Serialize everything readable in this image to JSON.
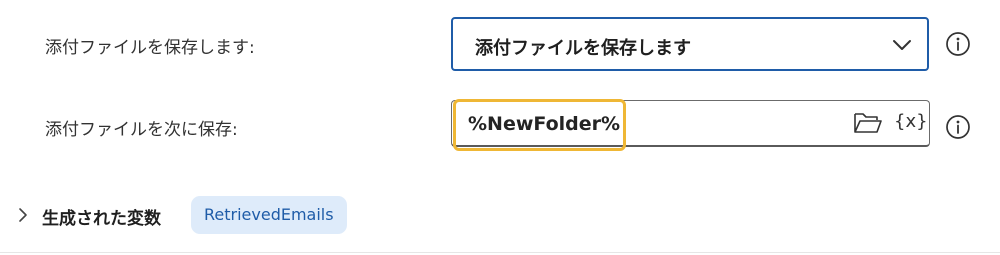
{
  "save_attachments": {
    "label": "添付ファイルを保存します:",
    "selected_value": "添付ファイルを保存します"
  },
  "save_to": {
    "label": "添付ファイルを次に保存:",
    "value": "%NewFolder%",
    "variable_button_label": "{x}",
    "highlight_color": "#efb735"
  },
  "produced_variables": {
    "title": "生成された変数",
    "variables": [
      "RetrievedEmails"
    ]
  },
  "icons": {
    "dropdown": "chevron-down-icon",
    "info": "info-icon",
    "folder": "folder-open-icon",
    "expand": "chevron-right-icon"
  },
  "colors": {
    "accent": "#1f5ca8",
    "chip_background": "#deebfa"
  }
}
